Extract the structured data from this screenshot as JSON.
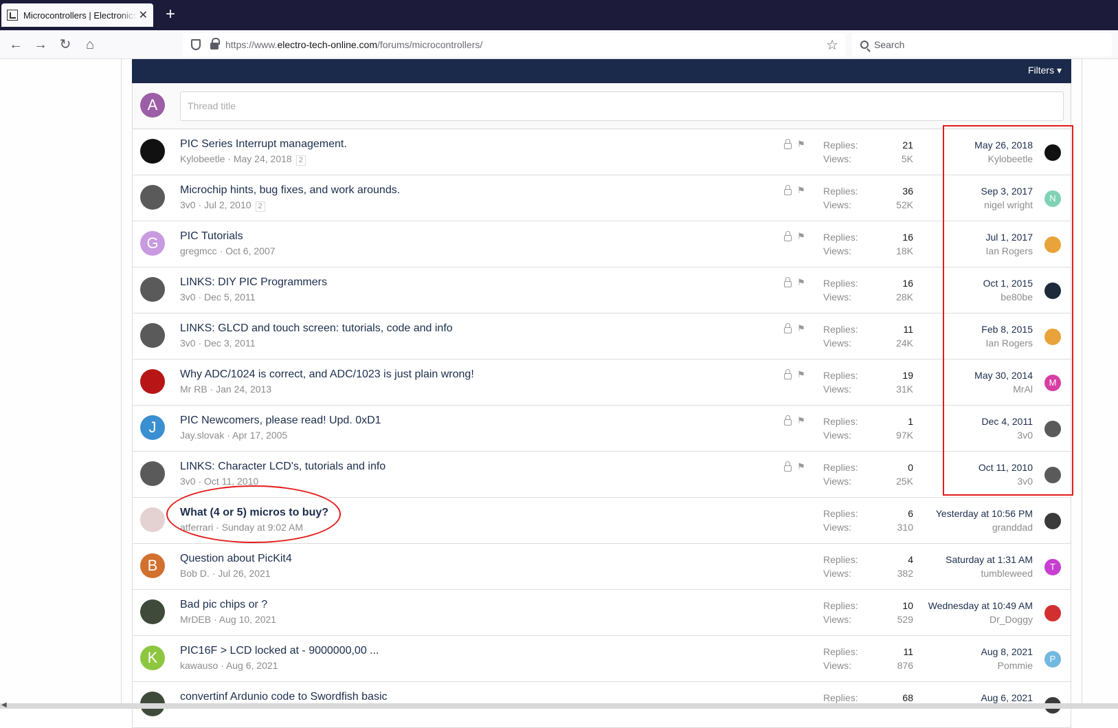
{
  "browser": {
    "tab_title": "Microcontrollers | Electronics Forum",
    "tab_close": "✕",
    "new_tab": "+",
    "back": "←",
    "forward": "→",
    "reload": "↻",
    "home": "⌂",
    "url_prefix": "https://www.",
    "url_domain": "electro-tech-online.com",
    "url_path": "/forums/microcontrollers/",
    "star": "☆",
    "search_placeholder": "Search"
  },
  "forum": {
    "filters_label": "Filters ▾",
    "composer_avatar_letter": "A",
    "thread_title_placeholder": "Thread title",
    "replies_label": "Replies:",
    "views_label": "Views:",
    "threads": [
      {
        "title": "PIC Series Interrupt management.",
        "author": "Kylobeetle",
        "date": "May 24, 2018",
        "pages": "2",
        "sticky": true,
        "replies": "21",
        "views": "5K",
        "last_date": "May 26, 2018",
        "last_user": "Kylobeetle",
        "avatar_letter": "",
        "avatar_color": "#111111",
        "lavatar_letter": "",
        "lavatar_color": "#111111"
      },
      {
        "title": "Microchip hints, bug fixes, and work arounds.",
        "author": "3v0",
        "date": "Jul 2, 2010",
        "pages": "2",
        "sticky": true,
        "replies": "36",
        "views": "52K",
        "last_date": "Sep 3, 2017",
        "last_user": "nigel wright",
        "avatar_letter": "",
        "avatar_color": "#5a5a5a",
        "lavatar_letter": "N",
        "lavatar_color": "#7fd3b4"
      },
      {
        "title": "PIC Tutorials",
        "author": "gregmcc",
        "date": "Oct 6, 2007",
        "pages": "",
        "sticky": true,
        "replies": "16",
        "views": "18K",
        "last_date": "Jul 1, 2017",
        "last_user": "Ian Rogers",
        "avatar_letter": "G",
        "avatar_color": "#c89be0",
        "lavatar_letter": "",
        "lavatar_color": "#e8a33a"
      },
      {
        "title": "LINKS: DIY PIC Programmers",
        "author": "3v0",
        "date": "Dec 5, 2011",
        "pages": "",
        "sticky": true,
        "replies": "16",
        "views": "28K",
        "last_date": "Oct 1, 2015",
        "last_user": "be80be",
        "avatar_letter": "",
        "avatar_color": "#5a5a5a",
        "lavatar_letter": "",
        "lavatar_color": "#1c2a3a"
      },
      {
        "title": "LINKS: GLCD and touch screen: tutorials, code and info",
        "author": "3v0",
        "date": "Dec 3, 2011",
        "pages": "",
        "sticky": true,
        "replies": "11",
        "views": "24K",
        "last_date": "Feb 8, 2015",
        "last_user": "Ian Rogers",
        "avatar_letter": "",
        "avatar_color": "#5a5a5a",
        "lavatar_letter": "",
        "lavatar_color": "#e8a33a"
      },
      {
        "title": "Why ADC/1024 is correct, and ADC/1023 is just plain wrong!",
        "author": "Mr RB",
        "date": "Jan 24, 2013",
        "pages": "",
        "sticky": true,
        "replies": "19",
        "views": "31K",
        "last_date": "May 30, 2014",
        "last_user": "MrAl",
        "avatar_letter": "",
        "avatar_color": "#b81616",
        "lavatar_letter": "M",
        "lavatar_color": "#d63fa4"
      },
      {
        "title": "PIC Newcomers, please read! Upd. 0xD1",
        "author": "Jay.slovak",
        "date": "Apr 17, 2005",
        "pages": "",
        "sticky": true,
        "replies": "1",
        "views": "97K",
        "last_date": "Dec 4, 2011",
        "last_user": "3v0",
        "avatar_letter": "J",
        "avatar_color": "#3a8fd0",
        "lavatar_letter": "",
        "lavatar_color": "#5a5a5a"
      },
      {
        "title": "LINKS: Character LCD's, tutorials and info",
        "author": "3v0",
        "date": "Oct 11, 2010",
        "pages": "",
        "sticky": true,
        "replies": "0",
        "views": "25K",
        "last_date": "Oct 11, 2010",
        "last_user": "3v0",
        "avatar_letter": "",
        "avatar_color": "#5a5a5a",
        "lavatar_letter": "",
        "lavatar_color": "#5a5a5a"
      },
      {
        "title": "What (4 or 5) micros to buy?",
        "author": "atferrari",
        "date": "Sunday at 9:02 AM",
        "pages": "",
        "sticky": false,
        "bold": true,
        "replies": "6",
        "views": "310",
        "last_date": "Yesterday at 10:56 PM",
        "last_user": "granddad",
        "avatar_letter": "",
        "avatar_color": "#e4d2d2",
        "lavatar_letter": "",
        "lavatar_color": "#3a3a3a"
      },
      {
        "title": "Question about PicKit4",
        "author": "Bob D.",
        "date": "Jul 26, 2021",
        "pages": "",
        "sticky": false,
        "replies": "4",
        "views": "382",
        "last_date": "Saturday at 1:31 AM",
        "last_user": "tumbleweed",
        "avatar_letter": "B",
        "avatar_color": "#d2702e",
        "lavatar_letter": "T",
        "lavatar_color": "#c63fd1"
      },
      {
        "title": "Bad pic chips or ?",
        "author": "MrDEB",
        "date": "Aug 10, 2021",
        "pages": "",
        "sticky": false,
        "replies": "10",
        "views": "529",
        "last_date": "Wednesday at 10:49 AM",
        "last_user": "Dr_Doggy",
        "avatar_letter": "",
        "avatar_color": "#3f4a3a",
        "lavatar_letter": "",
        "lavatar_color": "#d23030"
      },
      {
        "title": "PIC16F > LCD locked at - 9000000,00 ...",
        "author": "kawauso",
        "date": "Aug 6, 2021",
        "pages": "",
        "sticky": false,
        "replies": "11",
        "views": "876",
        "last_date": "Aug 8, 2021",
        "last_user": "Pommie",
        "avatar_letter": "K",
        "avatar_color": "#8dc63f",
        "lavatar_letter": "P",
        "lavatar_color": "#72b8e0"
      },
      {
        "title": "convertinf Ardunio code to Swordfish basic",
        "author": "",
        "date": "",
        "pages": "",
        "sticky": false,
        "replies": "68",
        "views": "",
        "last_date": "Aug 6, 2021",
        "last_user": "",
        "avatar_letter": "",
        "avatar_color": "#3f4a3a",
        "lavatar_letter": "",
        "lavatar_color": "#3a3a3a"
      }
    ]
  }
}
